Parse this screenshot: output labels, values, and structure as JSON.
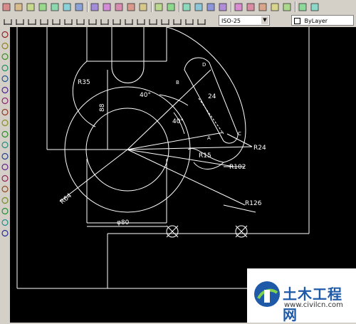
{
  "toolbar": {
    "dimstyle_value": "ISO-25",
    "layer_value": "ByLayer",
    "dropdown_arrow": "▼"
  },
  "drawing": {
    "dims": {
      "r35": "R35",
      "d88": "88",
      "ang40a": "40°",
      "ang40b": "40°",
      "d24": "24",
      "r15": "R15",
      "r24": "R24",
      "r102": "R102",
      "r126": "R126",
      "r64": "R64",
      "phi80": "φ80"
    },
    "points": {
      "a": "A",
      "b": "B",
      "c": "C",
      "d": "D"
    },
    "line_color": "#ffffff"
  },
  "watermark": {
    "title": "土木工程网",
    "url": "www.civilcn.com"
  },
  "icons": {
    "top_row": [
      "new-icon",
      "open-icon",
      "save-icon",
      "print-icon",
      "preview-icon",
      "publish-icon",
      "spell-icon",
      "cut-icon",
      "copy-icon",
      "paste-icon",
      "match-icon",
      "brush-icon",
      "undo-icon",
      "redo-icon",
      "pan-icon",
      "zoom-realtime-icon",
      "zoom-window-icon",
      "zoom-previous-icon",
      "properties-icon",
      "designcenter-icon",
      "toolpalette-icon",
      "sheetset-icon",
      "markup-icon",
      "calc-icon",
      "help-icon"
    ],
    "left_col": [
      "line-icon",
      "construction-line-icon",
      "polyline-icon",
      "polygon-icon",
      "rectangle-icon",
      "arc-icon",
      "circle-icon",
      "revcloud-icon",
      "spline-icon",
      "ellipse-icon",
      "ellipse-arc-icon",
      "insert-block-icon",
      "make-block-icon",
      "point-icon",
      "hatch-icon",
      "gradient-icon",
      "region-icon",
      "table-icon",
      "mtext-icon"
    ]
  }
}
